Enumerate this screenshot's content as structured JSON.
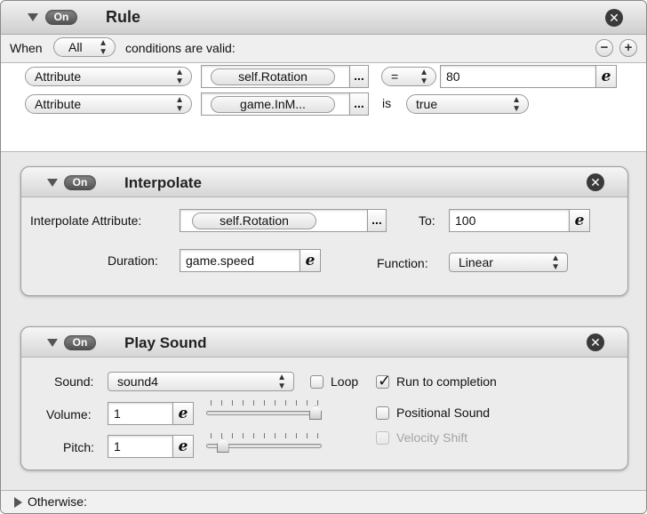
{
  "rule": {
    "on_label": "On",
    "title": "Rule",
    "when_label": "When",
    "when_value": "All",
    "conditions_text": "conditions are valid:",
    "conditions": [
      {
        "type": "Attribute",
        "attribute": "self.Rotation",
        "operator": "=",
        "value": "80"
      },
      {
        "type": "Attribute",
        "attribute": "game.InM...",
        "operator_text": "is",
        "value": "true"
      }
    ]
  },
  "interpolate": {
    "on_label": "On",
    "title": "Interpolate",
    "attr_label": "Interpolate Attribute:",
    "attr_value": "self.Rotation",
    "to_label": "To:",
    "to_value": "100",
    "duration_label": "Duration:",
    "duration_value": "game.speed",
    "function_label": "Function:",
    "function_value": "Linear"
  },
  "play_sound": {
    "on_label": "On",
    "title": "Play Sound",
    "sound_label": "Sound:",
    "sound_value": "sound4",
    "loop_label": "Loop",
    "loop_checked": false,
    "run_label": "Run to completion",
    "run_checked": true,
    "volume_label": "Volume:",
    "volume_value": "1",
    "positional_label": "Positional Sound",
    "positional_checked": false,
    "pitch_label": "Pitch:",
    "pitch_value": "1",
    "velocity_label": "Velocity Shift",
    "velocity_enabled": false,
    "volume_slider_fraction": 1.0,
    "pitch_slider_fraction": 0.1
  },
  "otherwise_label": "Otherwise:",
  "icons": {
    "close": "close-icon",
    "expand": "disclosure-triangle-icon",
    "expression": "expression-e-icon",
    "popup": "updown-arrows-icon",
    "checkmark": "checkmark-icon"
  },
  "symbols": {
    "e": "e",
    "dots": "...",
    "close": "✕",
    "minus": "−",
    "plus": "+",
    "check": "✓"
  }
}
